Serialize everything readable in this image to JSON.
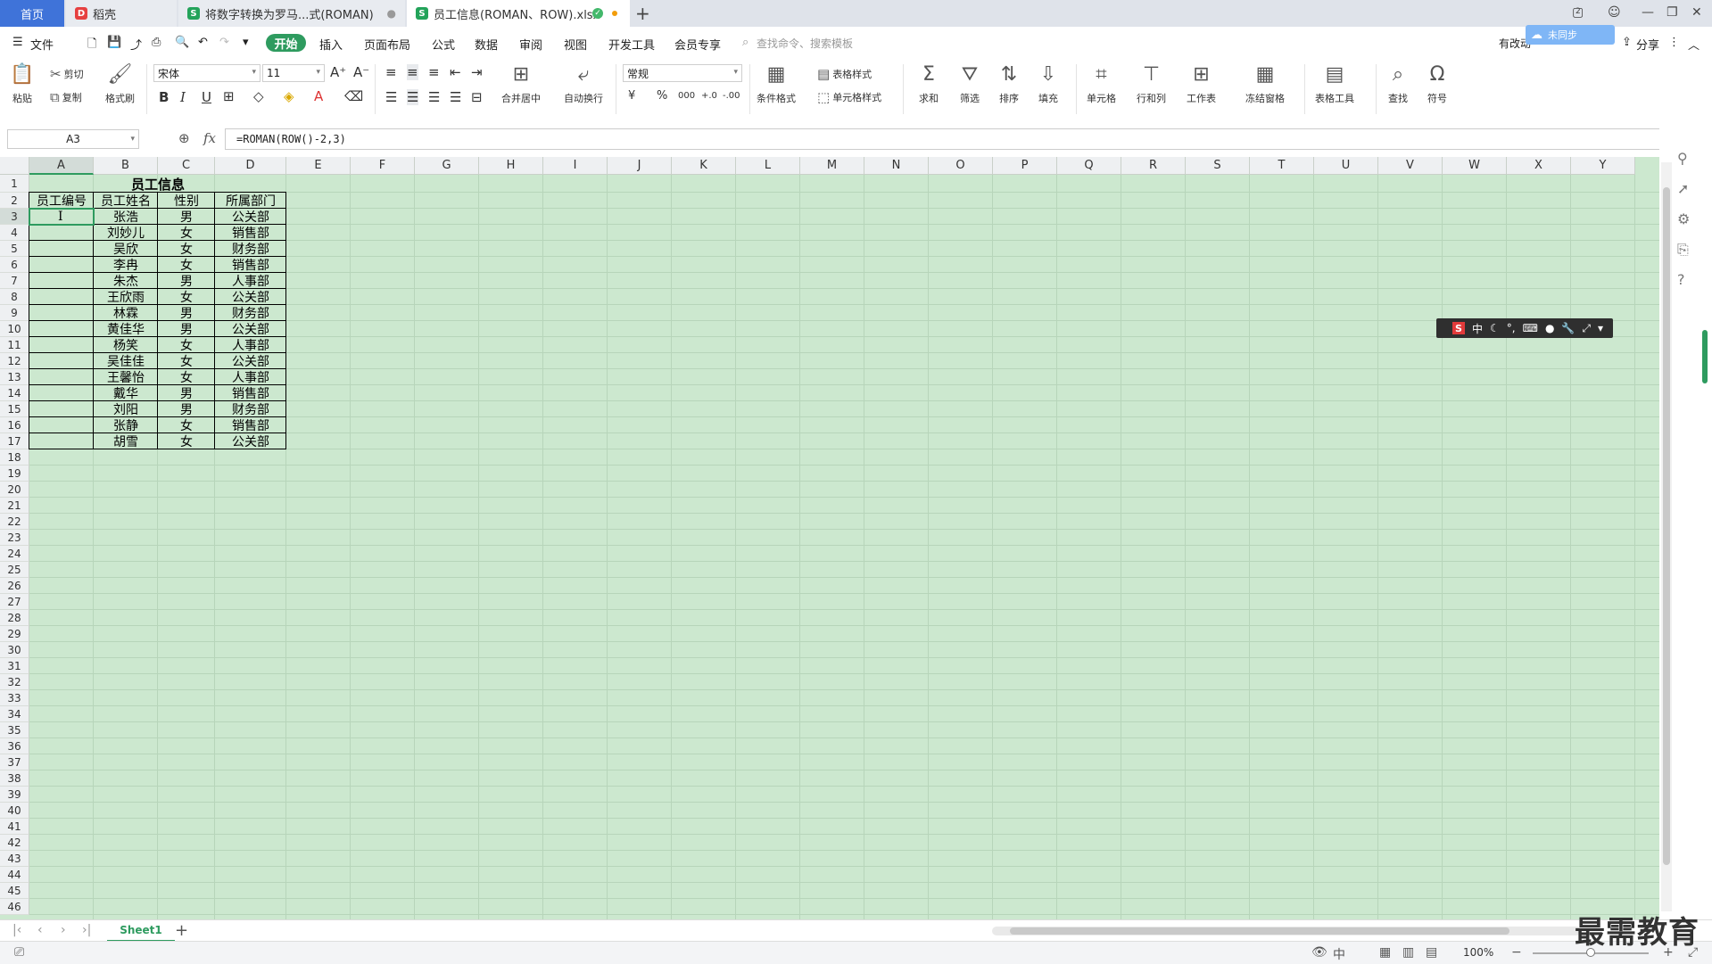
{
  "tabs": {
    "home": "首页",
    "tab1": "稻壳",
    "tab2": "将数字转换为罗马...式(ROMAN)",
    "tab3": "员工信息(ROMAN、ROW).xlsx",
    "add": "+"
  },
  "window": {
    "box_count": "2"
  },
  "menu": {
    "file": "文件",
    "start": "开始",
    "items": [
      "插入",
      "页面布局",
      "公式",
      "数据",
      "审阅",
      "视图",
      "开发工具",
      "会员专享"
    ],
    "search_placeholder": "查找命令、搜索模板",
    "share": "分享",
    "cloud": "有改动",
    "cloud_btn": "未同步"
  },
  "ribbon": {
    "paste": "粘贴",
    "cut": "剪切",
    "copy": "复制",
    "format_painter": "格式刷",
    "font_name": "宋体",
    "font_size": "11",
    "merge_center": "合并居中",
    "wrap_text": "自动换行",
    "number_format": "常规",
    "cond_format": "条件格式",
    "table_style": "表格样式",
    "cell_style": "单元格样式",
    "sum": "求和",
    "filter": "筛选",
    "sort": "排序",
    "fill": "填充",
    "cells": "单元格",
    "rows_cols": "行和列",
    "worksheet": "工作表",
    "freeze": "冻结窗格",
    "table_tools": "表格工具",
    "find": "查找",
    "symbol": "符号",
    "percent": "%",
    "thousands": "000",
    "inc_dec": "+.0",
    "dec_dec": "-.00",
    "currency": "¥"
  },
  "formula_bar": {
    "name_box": "A3",
    "fx": "fx",
    "formula": "=ROMAN(ROW()-2,3)"
  },
  "columns": [
    "A",
    "B",
    "C",
    "D",
    "E",
    "F",
    "G",
    "H",
    "I",
    "J",
    "K",
    "L",
    "M",
    "N",
    "O",
    "P",
    "Q",
    "R",
    "S",
    "T",
    "U",
    "V",
    "W",
    "X",
    "Y"
  ],
  "rows": [
    "1",
    "2",
    "3",
    "4",
    "5",
    "6",
    "7",
    "8",
    "9",
    "10",
    "11",
    "12",
    "13",
    "14",
    "15",
    "16",
    "17",
    "18",
    "19",
    "20",
    "21",
    "22",
    "23",
    "24",
    "25",
    "26",
    "27",
    "28",
    "29",
    "30",
    "31",
    "32",
    "33",
    "34",
    "35",
    "36",
    "37",
    "38",
    "39",
    "40",
    "41",
    "42",
    "43",
    "44",
    "45",
    "46"
  ],
  "sheet": {
    "title": "员工信息",
    "headers": [
      "员工编号",
      "员工姓名",
      "性别",
      "所属部门"
    ],
    "records": [
      [
        "",
        "张浩",
        "男",
        "公关部"
      ],
      [
        "",
        "刘妙儿",
        "女",
        "销售部"
      ],
      [
        "",
        "吴欣",
        "女",
        "财务部"
      ],
      [
        "",
        "李冉",
        "女",
        "销售部"
      ],
      [
        "",
        "朱杰",
        "男",
        "人事部"
      ],
      [
        "",
        "王欣雨",
        "女",
        "公关部"
      ],
      [
        "",
        "林霖",
        "男",
        "财务部"
      ],
      [
        "",
        "黄佳华",
        "男",
        "公关部"
      ],
      [
        "",
        "杨笑",
        "女",
        "人事部"
      ],
      [
        "",
        "吴佳佳",
        "女",
        "公关部"
      ],
      [
        "",
        "王馨怡",
        "女",
        "人事部"
      ],
      [
        "",
        "戴华",
        "男",
        "销售部"
      ],
      [
        "",
        "刘阳",
        "男",
        "财务部"
      ],
      [
        "",
        "张静",
        "女",
        "销售部"
      ],
      [
        "",
        "胡雪",
        "女",
        "公关部"
      ]
    ],
    "cursor": "I"
  },
  "ime": {
    "mode": "中"
  },
  "sheet_tabs": {
    "active": "Sheet1",
    "add": "+"
  },
  "status": {
    "zoom": "100%",
    "input_mode": "中"
  },
  "watermark": "最需教育",
  "colors": {
    "accent": "#2e9b5f",
    "grid_bg": "#cce8cf",
    "home_tab": "#3f73d9"
  }
}
